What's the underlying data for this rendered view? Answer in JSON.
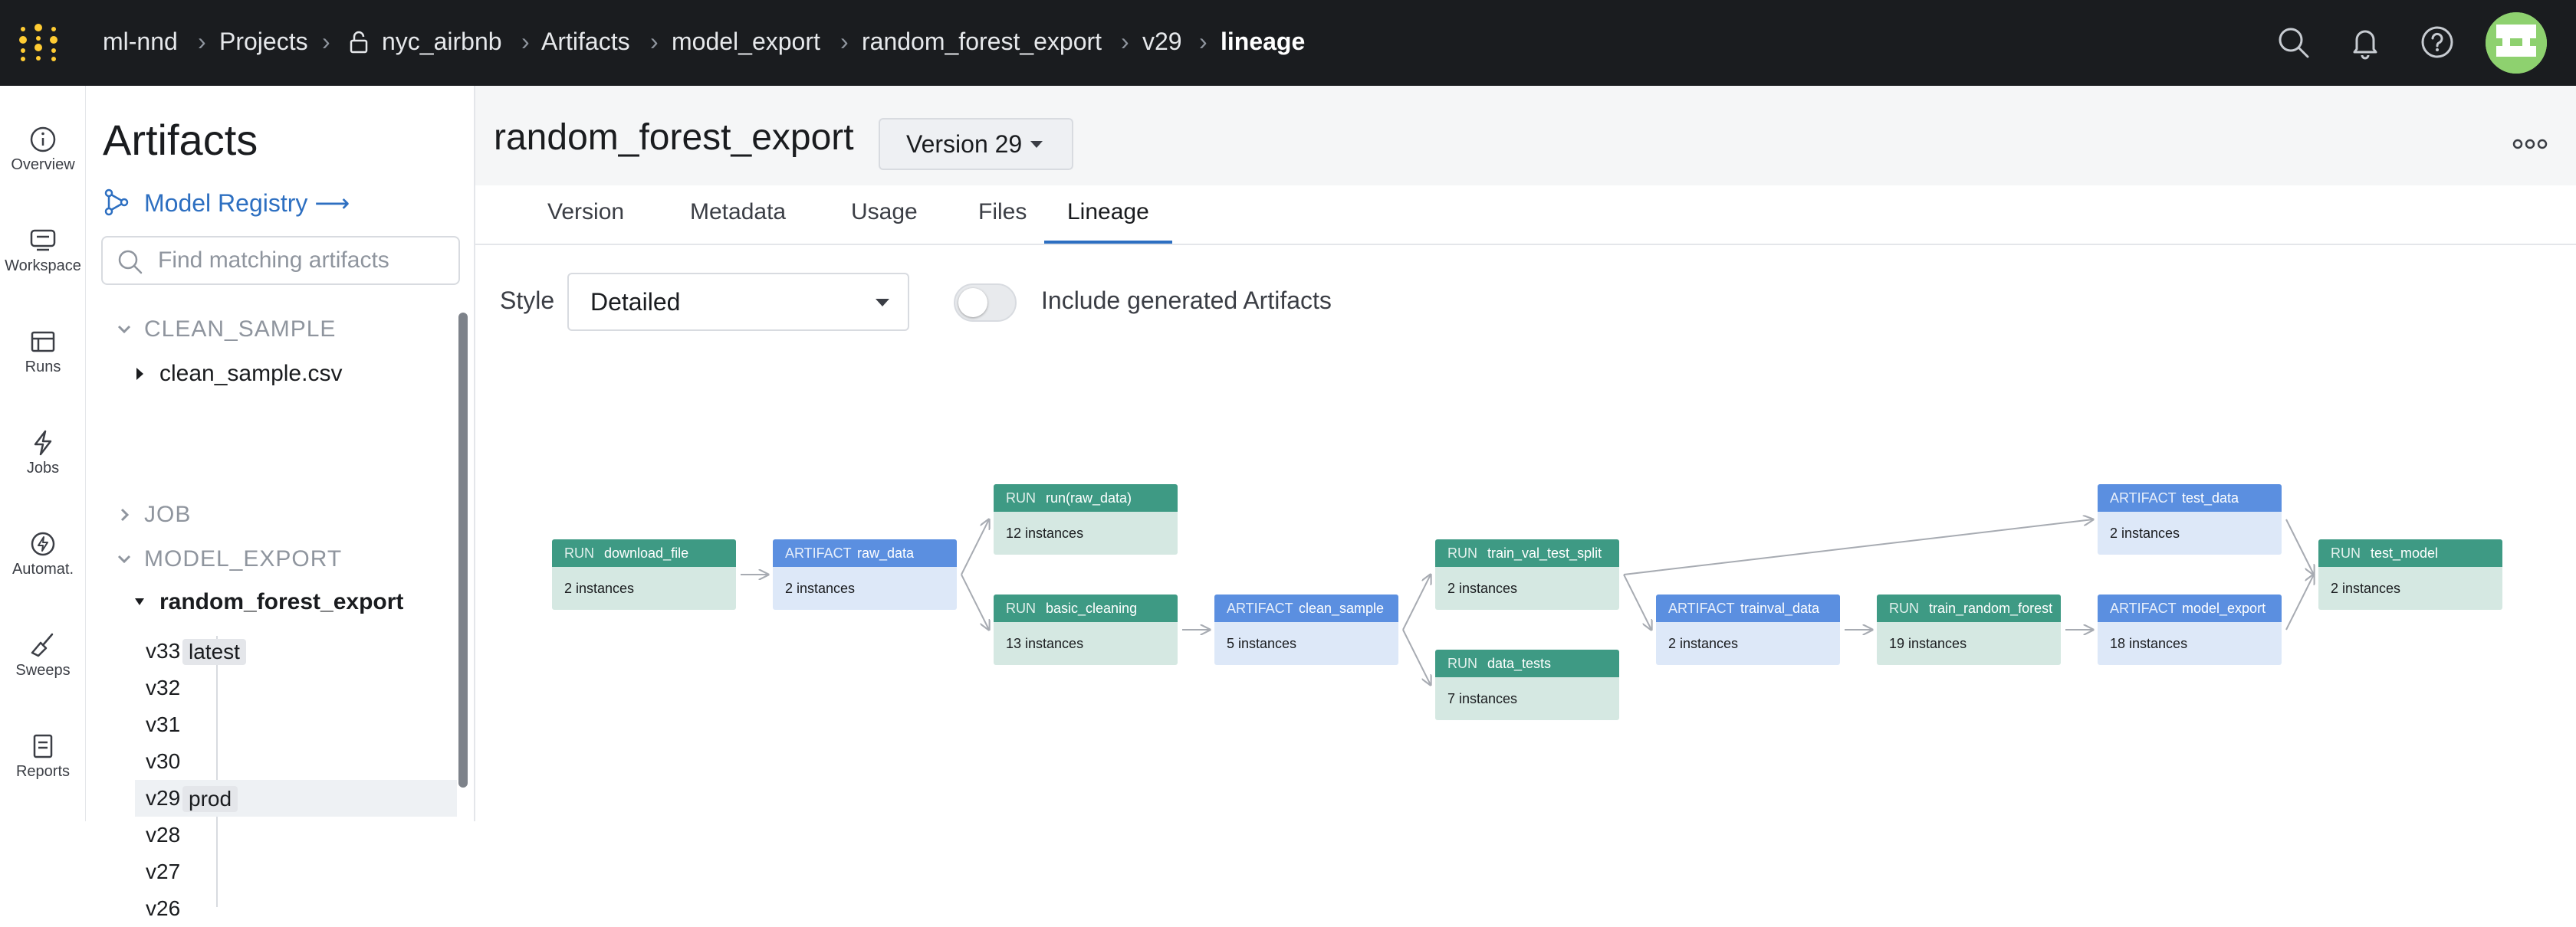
{
  "breadcrumb": [
    "ml-nnd",
    "Projects",
    "nyc_airbnb",
    "Artifacts",
    "model_export",
    "random_forest_export",
    "v29",
    "lineage"
  ],
  "rail": [
    {
      "label": "Overview",
      "icon": "info-icon"
    },
    {
      "label": "Workspace",
      "icon": "workspace-icon"
    },
    {
      "label": "Runs",
      "icon": "runs-table-icon"
    },
    {
      "label": "Jobs",
      "icon": "lightning-icon"
    },
    {
      "label": "Automat.",
      "icon": "automation-icon"
    },
    {
      "label": "Sweeps",
      "icon": "broom-icon"
    },
    {
      "label": "Reports",
      "icon": "report-icon"
    }
  ],
  "sidebar": {
    "title": "Artifacts",
    "registry_link": "Model Registry ⟶",
    "search_placeholder": "Find matching artifacts",
    "groups": {
      "clean_sample": "CLEAN_SAMPLE",
      "clean_sample_item": "clean_sample.csv",
      "job": "JOB",
      "model_export": "MODEL_EXPORT",
      "model_export_item": "random_forest_export"
    },
    "versions": [
      {
        "label": "v33",
        "tag": "latest"
      },
      {
        "label": "v32",
        "tag": ""
      },
      {
        "label": "v31",
        "tag": ""
      },
      {
        "label": "v30",
        "tag": ""
      },
      {
        "label": "v29",
        "tag": "prod"
      },
      {
        "label": "v28",
        "tag": ""
      },
      {
        "label": "v27",
        "tag": ""
      },
      {
        "label": "v26",
        "tag": ""
      }
    ]
  },
  "header": {
    "title": "random_forest_export",
    "version": "Version 29"
  },
  "tabs": [
    "Version",
    "Metadata",
    "Usage",
    "Files",
    "Lineage"
  ],
  "active_tab": "Lineage",
  "controls": {
    "style_label": "Style",
    "style_value": "Detailed",
    "toggle_label": "Include generated Artifacts",
    "toggle_on": false
  },
  "graph": {
    "nodes": [
      {
        "id": "n1",
        "kind": "RUN",
        "name": "download_file",
        "count": "2 instances"
      },
      {
        "id": "n2",
        "kind": "ARTIFACT",
        "name": "raw_data",
        "count": "2 instances"
      },
      {
        "id": "n3",
        "kind": "RUN",
        "name": "run(raw_data)",
        "count": "12 instances"
      },
      {
        "id": "n4",
        "kind": "RUN",
        "name": "basic_cleaning",
        "count": "13 instances"
      },
      {
        "id": "n5",
        "kind": "ARTIFACT",
        "name": "clean_sample",
        "count": "5 instances"
      },
      {
        "id": "n6",
        "kind": "RUN",
        "name": "train_val_test_split",
        "count": "2 instances"
      },
      {
        "id": "n7",
        "kind": "RUN",
        "name": "data_tests",
        "count": "7 instances"
      },
      {
        "id": "n8",
        "kind": "ARTIFACT",
        "name": "trainval_data",
        "count": "2 instances"
      },
      {
        "id": "n9",
        "kind": "RUN",
        "name": "train_random_forest",
        "count": "19 instances"
      },
      {
        "id": "n10",
        "kind": "ARTIFACT",
        "name": "test_data",
        "count": "2 instances"
      },
      {
        "id": "n11",
        "kind": "ARTIFACT",
        "name": "model_export",
        "count": "18 instances"
      },
      {
        "id": "n12",
        "kind": "RUN",
        "name": "test_model",
        "count": "2 instances"
      }
    ],
    "edges": [
      [
        "n1",
        "n2"
      ],
      [
        "n2",
        "n3"
      ],
      [
        "n2",
        "n4"
      ],
      [
        "n4",
        "n5"
      ],
      [
        "n5",
        "n6"
      ],
      [
        "n5",
        "n7"
      ],
      [
        "n6",
        "n10"
      ],
      [
        "n6",
        "n8"
      ],
      [
        "n8",
        "n9"
      ],
      [
        "n9",
        "n11"
      ],
      [
        "n10",
        "n12"
      ],
      [
        "n11",
        "n12"
      ]
    ]
  },
  "colors": {
    "run": "#3e9a84",
    "artifact": "#5b8fe0",
    "accent": "#2d6fc1",
    "topbar": "#1a1c1f"
  }
}
